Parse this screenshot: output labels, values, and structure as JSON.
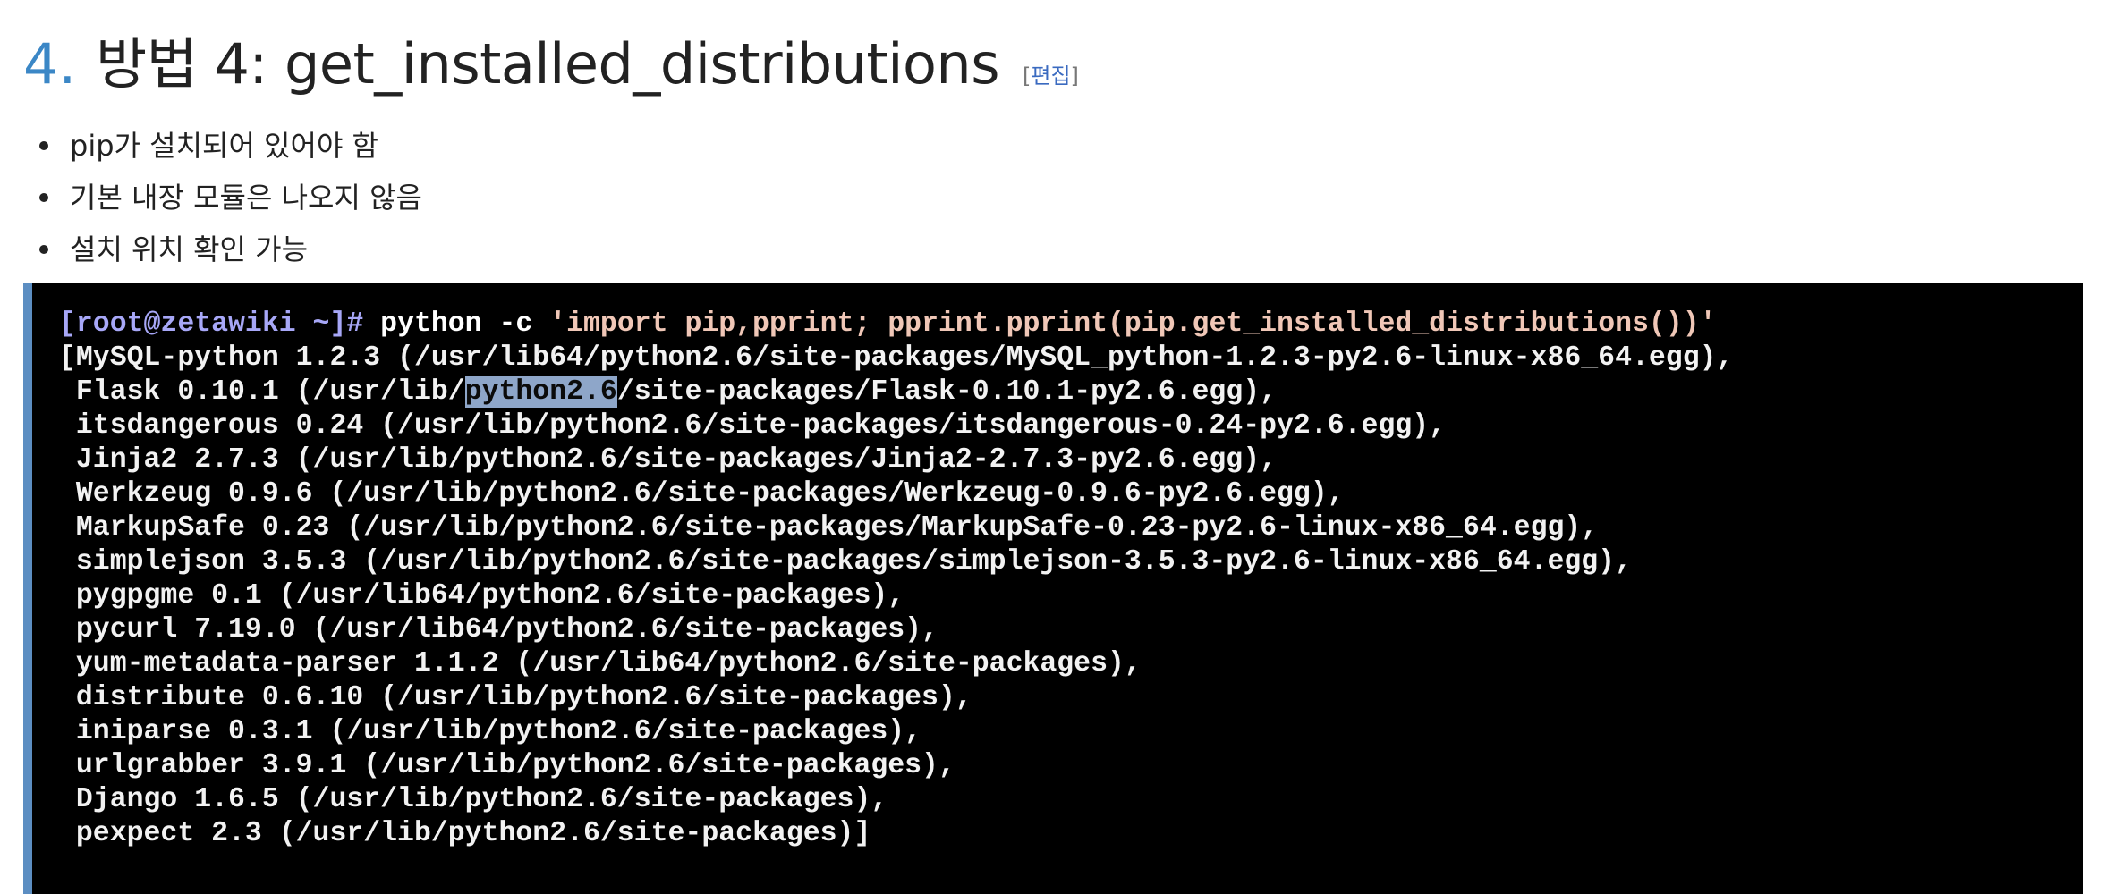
{
  "section": {
    "number": "4.",
    "title": "방법 4: get_installed_distributions",
    "edit_open": "[",
    "edit_label": "편집",
    "edit_close": "]"
  },
  "bullets": [
    "pip가 설치되어 있어야 함",
    "기본 내장 모듈은 나오지 않음",
    "설치 위치 확인 가능"
  ],
  "terminal": {
    "prompt": "[root@zetawiki ~]#",
    "command": "python -c",
    "command_arg": "'import pip,pprint; pprint.pprint(pip.get_installed_distributions())'",
    "output_lines": [
      "[MySQL-python 1.2.3 (/usr/lib64/python2.6/site-packages/MySQL_python-1.2.3-py2.6-linux-x86_64.egg),",
      " Flask 0.10.1 (/usr/lib/python2.6/site-packages/Flask-0.10.1-py2.6.egg),",
      " itsdangerous 0.24 (/usr/lib/python2.6/site-packages/itsdangerous-0.24-py2.6.egg),",
      " Jinja2 2.7.3 (/usr/lib/python2.6/site-packages/Jinja2-2.7.3-py2.6.egg),",
      " Werkzeug 0.9.6 (/usr/lib/python2.6/site-packages/Werkzeug-0.9.6-py2.6.egg),",
      " MarkupSafe 0.23 (/usr/lib/python2.6/site-packages/MarkupSafe-0.23-py2.6-linux-x86_64.egg),",
      " simplejson 3.5.3 (/usr/lib/python2.6/site-packages/simplejson-3.5.3-py2.6-linux-x86_64.egg),",
      " pygpgme 0.1 (/usr/lib64/python2.6/site-packages),",
      " pycurl 7.19.0 (/usr/lib64/python2.6/site-packages),",
      " yum-metadata-parser 1.1.2 (/usr/lib64/python2.6/site-packages),",
      " distribute 0.6.10 (/usr/lib/python2.6/site-packages),",
      " iniparse 0.3.1 (/usr/lib/python2.6/site-packages),",
      " urlgrabber 3.9.1 (/usr/lib/python2.6/site-packages),",
      " Django 1.6.5 (/usr/lib/python2.6/site-packages),",
      " pexpect 2.3 (/usr/lib/python2.6/site-packages)]"
    ],
    "selection": {
      "line": 1,
      "text": "python2.6"
    }
  },
  "colors": {
    "heading_number": "#3b87c6",
    "terminal_bg": "#000000",
    "terminal_border": "#5c8ec2",
    "prompt": "#a7a7f7",
    "command_string": "#f0c7b7",
    "selection": "#8ea6c9"
  }
}
